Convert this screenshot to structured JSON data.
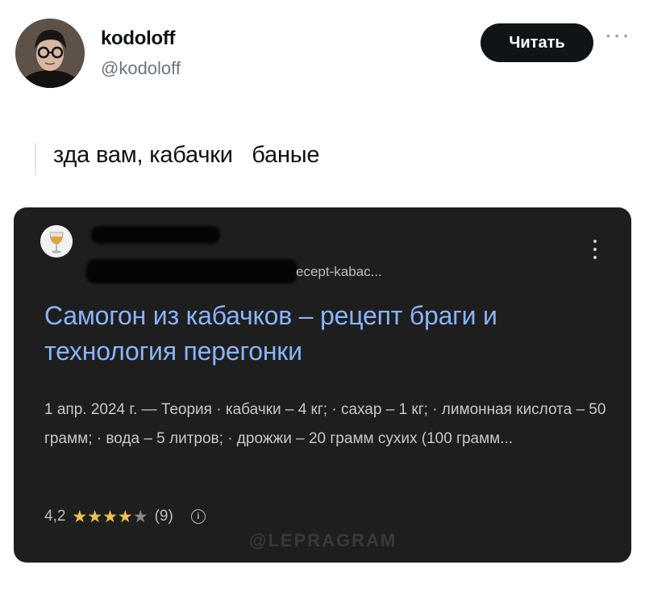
{
  "user": {
    "name": "kodoloff",
    "handle": "@kodoloff"
  },
  "follow_button": {
    "label": "Читать"
  },
  "more_icon": "more-dots-icon",
  "tweet": {
    "text": "зда вам, кабачки   баные"
  },
  "search_card": {
    "url_snippet": "ecept-kabac...",
    "title": "Самогон из кабачков – рецепт браги и технология перегонки",
    "snippet": "1 апр. 2024 г. — Теория · кабачки – 4 кг; · сахар – 1 кг; · лимонная кислота – 50 грамм; · вода – 5 литров; · дрожжи – 20 грамм сухих (100 грамм...",
    "rating": {
      "value": "4,2",
      "stars_filled": 4,
      "stars_total": 5,
      "count": "(9)"
    },
    "info_icon_glyph": "i",
    "watermark": "@LEPRAGRAM"
  },
  "colors": {
    "card_bg": "#1e1e1f",
    "link_blue": "#8ab4f8",
    "follow_bg": "#0f1419",
    "star_gold": "#f0c14b"
  }
}
